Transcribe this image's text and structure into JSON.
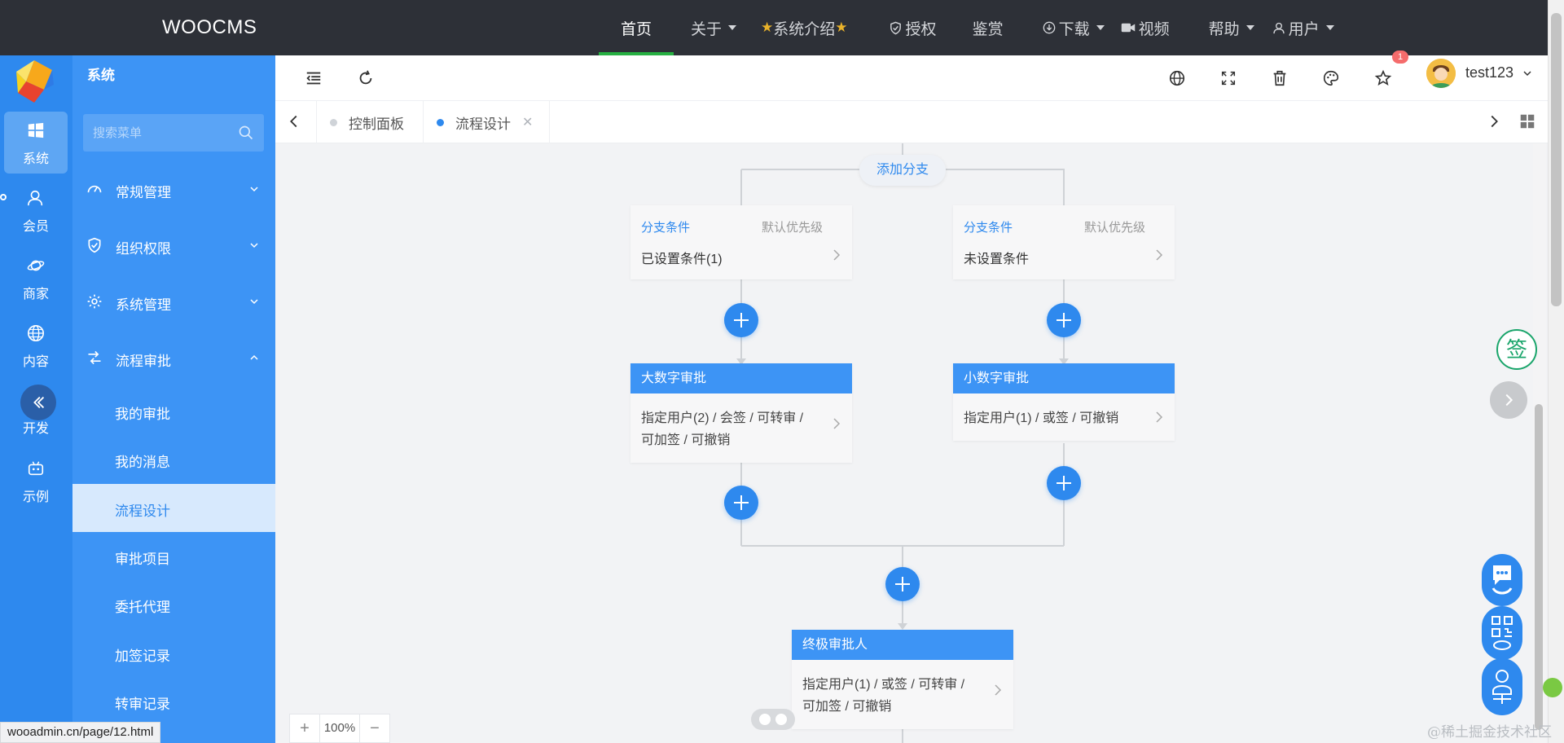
{
  "brand": "WOOCMS",
  "topnav": [
    {
      "label": "首页",
      "active": true,
      "caret": false,
      "icon": null
    },
    {
      "label": "关于",
      "active": false,
      "caret": true,
      "icon": null
    },
    {
      "label": "系统介绍",
      "active": false,
      "caret": false,
      "icon": "star-icon"
    },
    {
      "label": "授权",
      "active": false,
      "caret": false,
      "icon": "shield-icon"
    },
    {
      "label": "鉴赏",
      "active": false,
      "caret": false,
      "icon": null
    },
    {
      "label": "下载",
      "active": false,
      "caret": true,
      "icon": "download-icon"
    },
    {
      "label": "视频",
      "active": false,
      "caret": false,
      "icon": "video-icon"
    },
    {
      "label": "帮助",
      "active": false,
      "caret": true,
      "icon": null
    },
    {
      "label": "用户",
      "active": false,
      "caret": true,
      "icon": "user-icon"
    }
  ],
  "rail": [
    {
      "label": "系统",
      "icon": "windows-icon",
      "active": true
    },
    {
      "label": "会员",
      "icon": "member-icon",
      "active": false
    },
    {
      "label": "商家",
      "icon": "planet-icon",
      "active": false
    },
    {
      "label": "内容",
      "icon": "globe-icon",
      "active": false
    },
    {
      "label": "开发",
      "icon": "collapse-icon",
      "active": false
    },
    {
      "label": "示例",
      "icon": "robot-icon",
      "active": false
    }
  ],
  "submenu": {
    "title": "系统",
    "search_placeholder": "搜索菜单",
    "groups": [
      {
        "label": "常规管理",
        "icon": "dashboard-icon",
        "expanded": false
      },
      {
        "label": "组织权限",
        "icon": "shield-check-icon",
        "expanded": false
      },
      {
        "label": "系统管理",
        "icon": "gear-icon",
        "expanded": false
      },
      {
        "label": "流程审批",
        "icon": "flow-icon",
        "expanded": true
      }
    ],
    "items": [
      {
        "label": "我的审批",
        "active": false
      },
      {
        "label": "我的消息",
        "active": false
      },
      {
        "label": "流程设计",
        "active": true
      },
      {
        "label": "审批项目",
        "active": false
      },
      {
        "label": "委托代理",
        "active": false
      },
      {
        "label": "加签记录",
        "active": false
      },
      {
        "label": "转审记录",
        "active": false
      }
    ]
  },
  "header": {
    "username": "test123",
    "badge": "1"
  },
  "tabs": [
    {
      "label": "控制面板",
      "active": false,
      "closable": false
    },
    {
      "label": "流程设计",
      "active": true,
      "closable": true
    }
  ],
  "flow": {
    "add_branch": "添加分支",
    "branches": [
      {
        "condition_title": "分支条件",
        "priority": "默认优先级",
        "condition_text": "已设置条件(1)",
        "node_title": "大数字审批",
        "node_text": "指定用户(2) / 会签 / 可转审 / 可加签 / 可撤销"
      },
      {
        "condition_title": "分支条件",
        "priority": "默认优先级",
        "condition_text": "未设置条件",
        "node_title": "小数字审批",
        "node_text": "指定用户(1) / 或签 / 可撤销"
      }
    ],
    "final": {
      "node_title": "终极审批人",
      "node_text": "指定用户(1) / 或签 / 可转审 / 可加签 / 可撤销"
    }
  },
  "zoom": {
    "value": "100%",
    "plus": "+",
    "minus": "−"
  },
  "status_url": "wooadmin.cn/page/12.html",
  "sign_label": "签",
  "watermark": "@稀土掘金技术社区",
  "colors": {
    "topbar": "#2d3037",
    "primary": "#2e89ee",
    "active_nav": "#27b042"
  }
}
